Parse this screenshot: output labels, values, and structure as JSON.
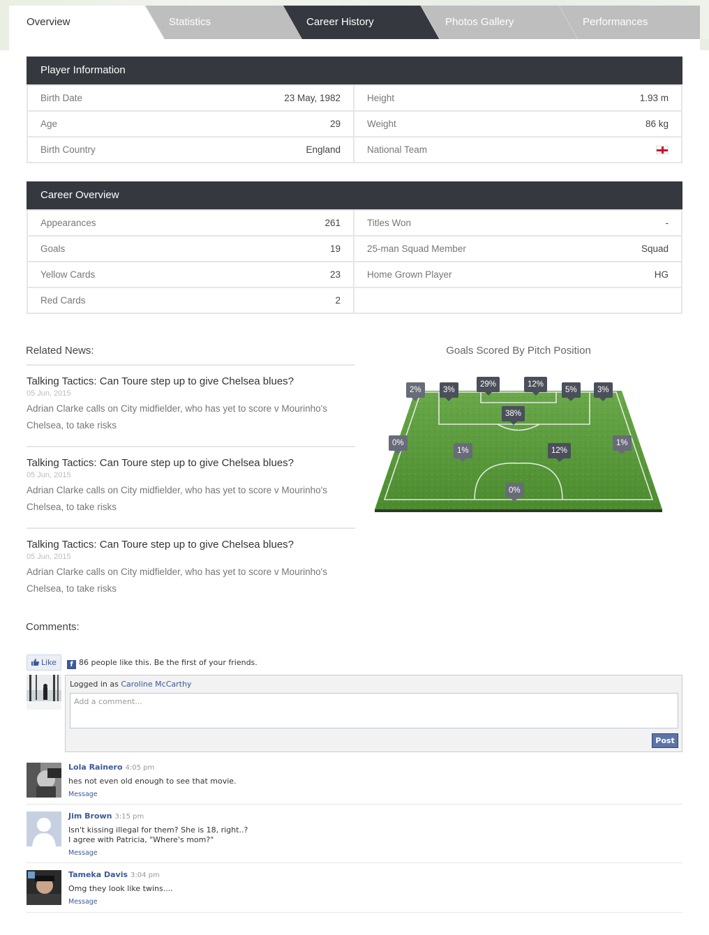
{
  "tabs": [
    {
      "label": "Overview"
    },
    {
      "label": "Statistics"
    },
    {
      "label": "Career History"
    },
    {
      "label": "Photos Gallery"
    },
    {
      "label": "Performances"
    }
  ],
  "player_info": {
    "title": "Player Information",
    "rows": [
      {
        "k": "Birth Date",
        "v": "23 May, 1982"
      },
      {
        "k": "Height",
        "v": "1.93 m"
      },
      {
        "k": "Age",
        "v": "29"
      },
      {
        "k": "Weight",
        "v": "86 kg"
      },
      {
        "k": "Birth Country",
        "v": "England"
      },
      {
        "k": "National Team",
        "v": ""
      }
    ],
    "flag_icon": "england-flag-icon"
  },
  "career": {
    "title": "Career Overview",
    "rows": [
      {
        "k": "Appearances",
        "v": "261"
      },
      {
        "k": "Titles Won",
        "v": "-"
      },
      {
        "k": "Goals",
        "v": "19"
      },
      {
        "k": "25-man Squad Member",
        "v": "Squad"
      },
      {
        "k": "Yellow Cards",
        "v": "23"
      },
      {
        "k": "Home Grown Player",
        "v": "HG"
      },
      {
        "k": "Red Cards",
        "v": "2"
      },
      {
        "k": "",
        "v": ""
      }
    ]
  },
  "news": {
    "title": "Related News:",
    "items": [
      {
        "title": "Talking Tactics: Can Toure step up to give Chelsea blues?",
        "date": "05 Jun, 2015",
        "body": "Adrian Clarke calls on City midfielder, who has yet to score v Mourinho's Chelsea, to take risks"
      },
      {
        "title": "Talking Tactics: Can Toure step up to give Chelsea blues?",
        "date": "05 Jun, 2015",
        "body": "Adrian Clarke calls on City midfielder, who has yet to score v Mourinho's Chelsea, to take risks"
      },
      {
        "title": "Talking Tactics: Can Toure step up to give Chelsea blues?",
        "date": "05 Jun, 2015",
        "body": "Adrian Clarke calls on City midfielder, who has yet to score v Mourinho's Chelsea, to take risks"
      }
    ]
  },
  "pitch": {
    "title": "Goals Scored By Pitch Position",
    "zones": [
      {
        "label": "2%",
        "style": "light"
      },
      {
        "label": "3%",
        "style": "dark"
      },
      {
        "label": "29%",
        "style": "dark"
      },
      {
        "label": "12%",
        "style": "dark"
      },
      {
        "label": "5%",
        "style": "dark"
      },
      {
        "label": "3%",
        "style": "dark"
      },
      {
        "label": "38%",
        "style": "dark"
      },
      {
        "label": "0%",
        "style": "light"
      },
      {
        "label": "1%",
        "style": "light"
      },
      {
        "label": "12%",
        "style": "dark"
      },
      {
        "label": "1%",
        "style": "light"
      },
      {
        "label": "0%",
        "style": "light"
      }
    ]
  },
  "comments": {
    "title": "Comments:",
    "like_label": "Like",
    "like_text": "86 people like this. Be the first of your friends.",
    "logged_prefix": "Logged in as",
    "logged_user": "Caroline McCarthy",
    "placeholder": "Add a comment...",
    "post_label": "Post",
    "items": [
      {
        "name": "Lola Rainero",
        "time": "4:05 pm",
        "lines": [
          "hes not even old enough to see that movie."
        ],
        "action": "Message"
      },
      {
        "name": "Jim Brown",
        "time": "3:15 pm",
        "lines": [
          "Isn't kissing illegal for them? She is 18, right..?",
          "I agree with Patricia, \"Where's mom?\""
        ],
        "action": "Message"
      },
      {
        "name": "Tameka Davis",
        "time": "3:04 pm",
        "lines": [
          "Omg they look like twins...."
        ],
        "action": "Message"
      }
    ]
  },
  "colors": {
    "header_dark": "#35383f",
    "tab_grey": "#bdbdbd",
    "tab_active": "#35383f",
    "pitch_green": "#4e8a32",
    "fb_blue": "#3b5998"
  }
}
